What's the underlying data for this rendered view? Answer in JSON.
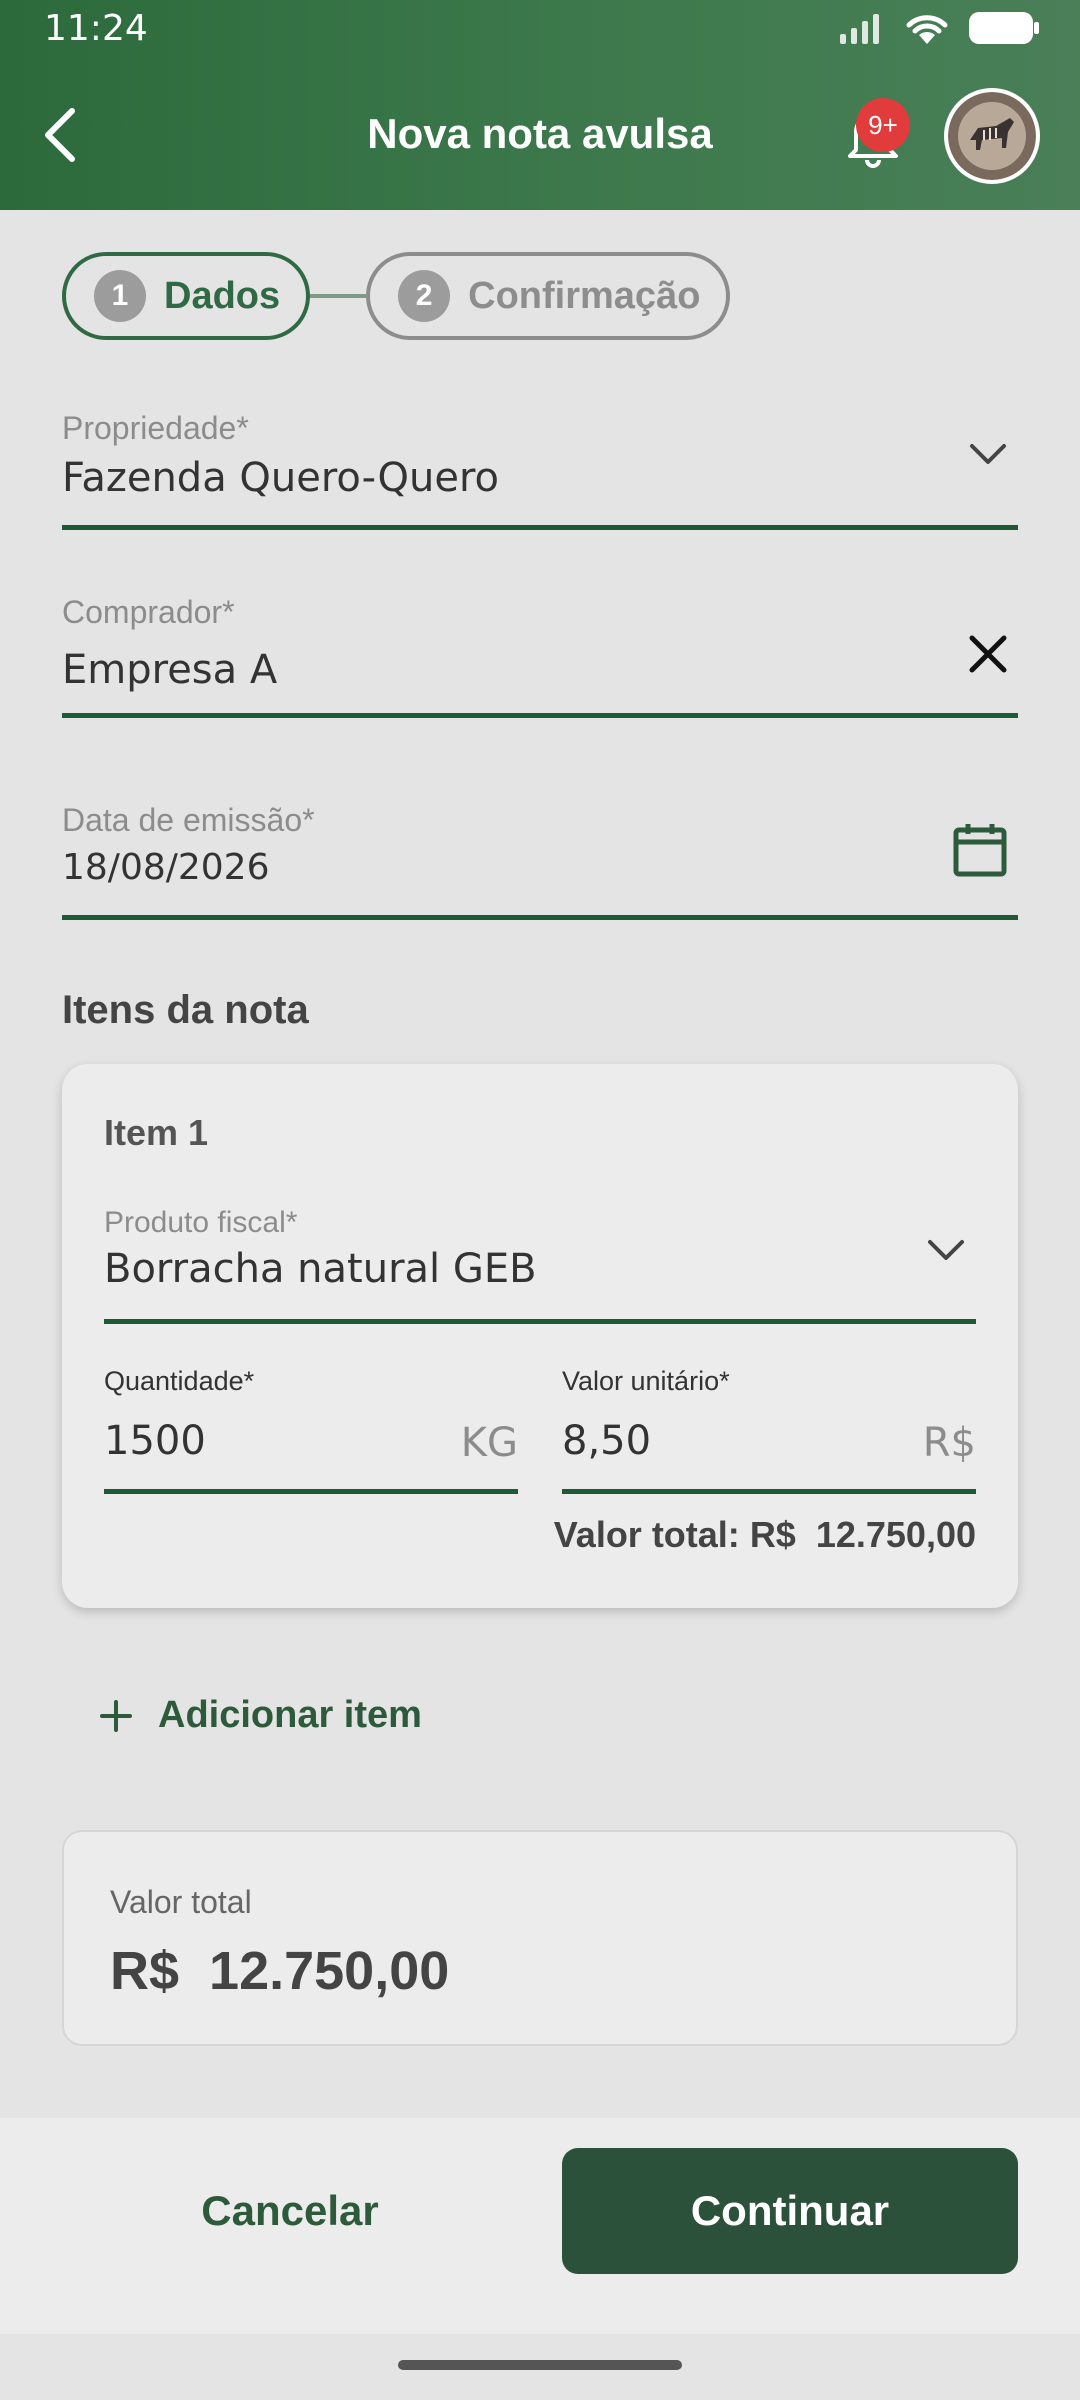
{
  "status_bar": {
    "time": "11:24"
  },
  "header": {
    "title": "Nova nota avulsa",
    "notification_badge": "9+",
    "back_icon": "chevron-left-icon",
    "bell_icon": "bell-icon",
    "accent_color": "#2c6a3c"
  },
  "stepper": {
    "steps": [
      {
        "number": "1",
        "label": "Dados",
        "state": "active"
      },
      {
        "number": "2",
        "label": "Confirmação",
        "state": "inactive"
      }
    ]
  },
  "form": {
    "propriedade": {
      "label": "Propriedade*",
      "value": "Fazenda Quero-Quero"
    },
    "comprador": {
      "label": "Comprador*",
      "value": "Empresa A"
    },
    "data_emissao": {
      "label": "Data de emissão*",
      "value": "18/08/2026"
    }
  },
  "items_section": {
    "title": "Itens da nota",
    "items": [
      {
        "title": "Item 1",
        "produto": {
          "label": "Produto fiscal*",
          "value": "Borracha natural GEB"
        },
        "quantidade": {
          "label": "Quantidade*",
          "value": "1500",
          "unit": "KG"
        },
        "valor_unitario": {
          "label": "Valor unitário*",
          "value": "8,50",
          "unit": "R$"
        },
        "total_label": "Valor total:",
        "total_value": "R$  12.750,00"
      }
    ],
    "add_item_label": "Adicionar item"
  },
  "summary": {
    "label": "Valor total",
    "value": "R$  12.750,00"
  },
  "actions": {
    "cancel": "Cancelar",
    "continue": "Continuar"
  }
}
